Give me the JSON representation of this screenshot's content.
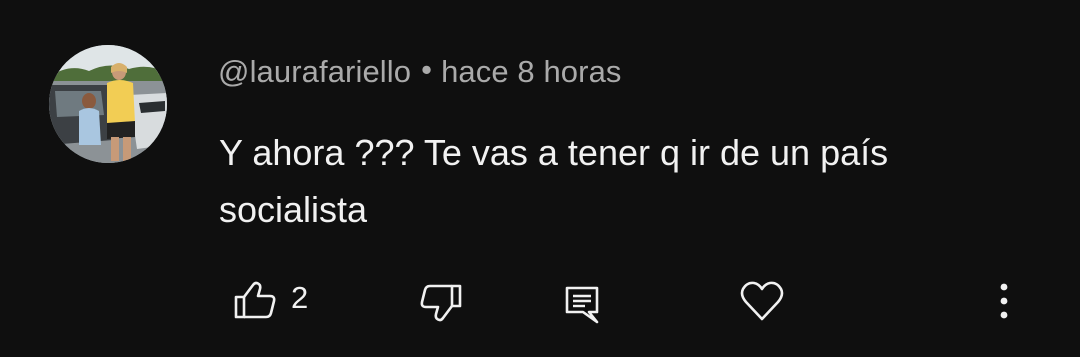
{
  "comment": {
    "author": "@laurafariello",
    "separator": "•",
    "timestamp": "hace 8 horas",
    "text": "Y ahora ??? Te vas a tener q ir de un país socialista",
    "like_count": "2"
  },
  "actions": {
    "like_icon": "thumbs-up-icon",
    "dislike_icon": "thumbs-down-icon",
    "reply_icon": "reply-comment-icon",
    "heart_icon": "heart-icon",
    "more_icon": "more-vertical-icon"
  },
  "colors": {
    "background": "#0f0f0f",
    "primary_text": "#f1f1f1",
    "secondary_text": "#aaaaaa"
  }
}
